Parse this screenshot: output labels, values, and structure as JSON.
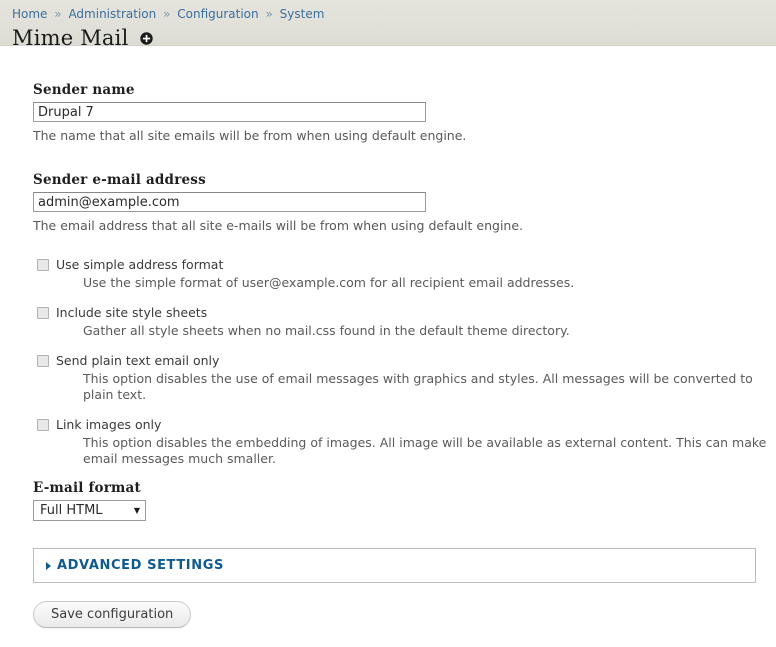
{
  "header": {
    "breadcrumb": {
      "separator": "»",
      "items": [
        {
          "label": "Home"
        },
        {
          "label": "Administration"
        },
        {
          "label": "Configuration"
        },
        {
          "label": "System"
        }
      ]
    },
    "title": "Mime Mail",
    "title_action_icon": "plus-circle-icon"
  },
  "form": {
    "sender_name": {
      "label": "Sender name",
      "value": "Drupal 7",
      "placeholder": "",
      "description": "The name that all site emails will be from when using default engine."
    },
    "sender_email": {
      "label": "Sender e-mail address",
      "value": "admin@example.com",
      "placeholder": "",
      "description": "The email address that all site e-mails will be from when using default engine."
    },
    "checkboxes": [
      {
        "label": "Use simple address format",
        "checked": false,
        "description": "Use the simple format of user@example.com for all recipient email addresses."
      },
      {
        "label": "Include site style sheets",
        "checked": false,
        "description": "Gather all style sheets when no mail.css found in the default theme directory."
      },
      {
        "label": "Send plain text email only",
        "checked": false,
        "description": "This option disables the use of email messages with graphics and styles. All messages will be converted to plain text."
      },
      {
        "label": "Link images only",
        "checked": false,
        "description": "This option disables the embedding of images. All image will be available as external content. This can make email messages much smaller."
      }
    ],
    "email_format": {
      "label": "E-mail format",
      "selected": "Full HTML",
      "arrow_icon": "chevron-down-icon"
    },
    "advanced_settings": {
      "label": "ADVANCED SETTINGS",
      "collapsed": true,
      "toggle_icon": "triangle-right-icon"
    },
    "submit": {
      "label": "Save configuration"
    }
  },
  "colors": {
    "header_bg": "#e0e0d8",
    "link": "#3c6e9e",
    "fieldset_accent": "#0f5b8e",
    "text": "#3b3b3b"
  }
}
